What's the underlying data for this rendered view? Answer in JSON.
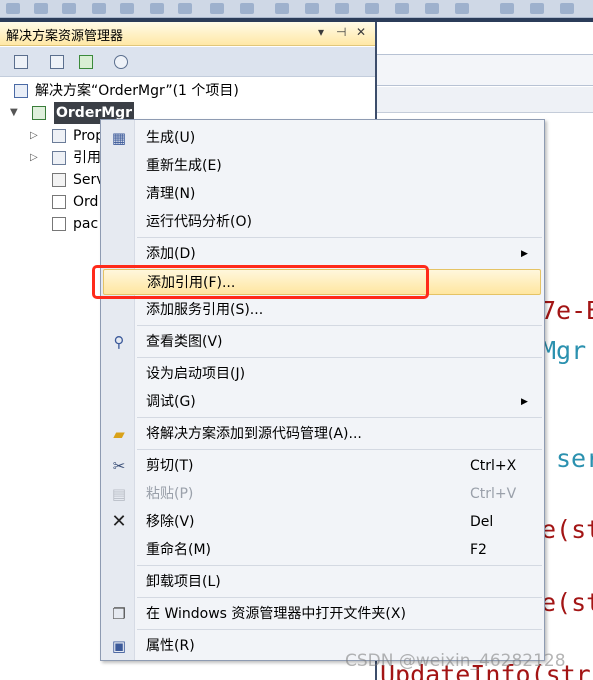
{
  "panel": {
    "title": "解决方案资源管理器",
    "title_controls": [
      "▾",
      "⊣",
      "✕"
    ],
    "toolbar_icons": [
      "properties-icon",
      "show-all-files-icon",
      "refresh-icon",
      "class-diagram-icon"
    ]
  },
  "tree": {
    "solution": "解决方案“OrderMgr”(1 个项目)",
    "project": "OrderMgr",
    "children": [
      "Prop",
      "引用",
      "Serv",
      "Ord",
      "pac"
    ]
  },
  "editor": {
    "code_fragments": [
      "7e-B",
      "Mgr",
      "ser",
      "e(st",
      "e(st",
      "UpdateInfo(stri"
    ]
  },
  "menu": {
    "items": [
      {
        "label": "生成(U)",
        "icon": "build-icon"
      },
      {
        "label": "重新生成(E)"
      },
      {
        "label": "清理(N)"
      },
      {
        "label": "运行代码分析(O)"
      },
      {
        "label": "添加(D)",
        "submenu": "▶"
      },
      {
        "label": "添加引用(F)...",
        "highlighted": true
      },
      {
        "label": "添加服务引用(S)..."
      },
      {
        "label": "查看类图(V)",
        "icon": "class-diagram-icon"
      },
      {
        "label": "设为启动项目(J)"
      },
      {
        "label": "调试(G)",
        "submenu": "▶"
      },
      {
        "label": "将解决方案添加到源代码管理(A)...",
        "icon": "add-to-source-control-icon"
      },
      {
        "label": "剪切(T)",
        "shortcut": "Ctrl+X",
        "icon": "scissors-icon"
      },
      {
        "label": "粘贴(P)",
        "shortcut": "Ctrl+V",
        "disabled": true,
        "icon": "paste-icon"
      },
      {
        "label": "移除(V)",
        "shortcut": "Del",
        "icon": "remove-x-icon"
      },
      {
        "label": "重命名(M)",
        "shortcut": "F2"
      },
      {
        "label": "卸载项目(L)"
      },
      {
        "label": "在 Windows 资源管理器中打开文件夹(X)",
        "icon": "open-folder-icon"
      },
      {
        "label": "属性(R)",
        "icon": "properties-icon"
      }
    ]
  },
  "watermark": "CSDN @weixin_46282128",
  "colors": {
    "highlight_border": "#ff2a1a",
    "code_red": "#a31515",
    "code_teal": "#2b91af",
    "code_blue": "#0000ff"
  }
}
